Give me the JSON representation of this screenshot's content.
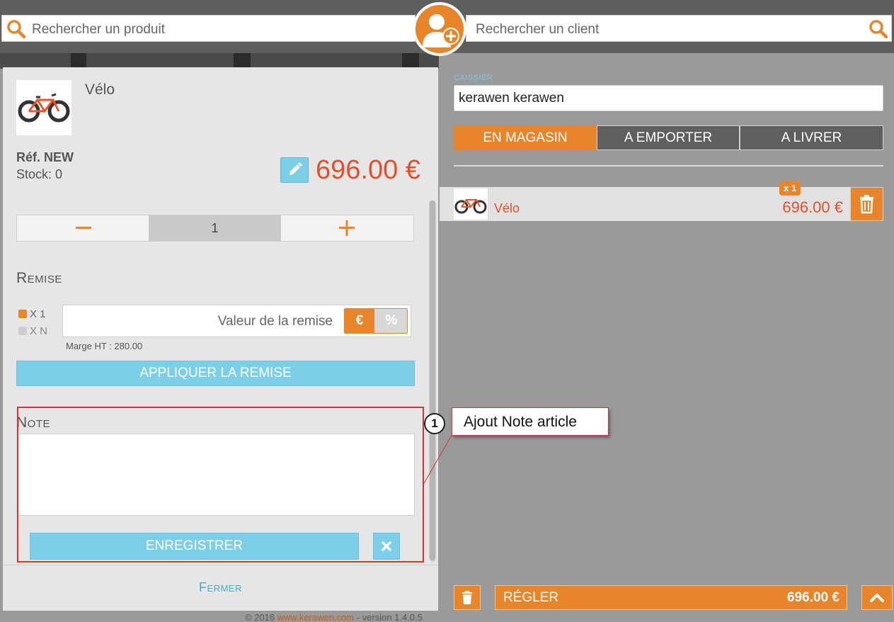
{
  "search": {
    "product_placeholder": "Rechercher un produit",
    "client_placeholder": "Rechercher un client"
  },
  "product": {
    "title": "Vélo",
    "ref": "Réf. NEW",
    "stock": "Stock: 0",
    "price": "696.00 €",
    "quantity": "1",
    "remise_title": "Remise",
    "option_x1": "X 1",
    "option_xn": "X N",
    "remise_placeholder": "Valeur de la remise",
    "unit_euro": "€",
    "unit_percent": "%",
    "marge": "Marge HT : 280.00",
    "apply_label": "APPLIQUER LA REMISE",
    "note_title": "Note",
    "save_label": "ENREGISTRER",
    "close_label": "Fermer"
  },
  "footer": {
    "copyright": "© 2016 ",
    "link": "www.kerawen.com",
    "version": " - version 1.4.0.5"
  },
  "cashier": {
    "label": "CAISSIER",
    "value": "kerawen kerawen"
  },
  "tabs": [
    {
      "label": "EN MAGASIN",
      "active": true
    },
    {
      "label": "A EMPORTER",
      "active": false
    },
    {
      "label": "A LIVRER",
      "active": false
    }
  ],
  "cart": {
    "item_name": "Vélo",
    "item_qty": "x 1",
    "item_price": "696.00 €"
  },
  "checkout": {
    "pay_label": "RÉGLER",
    "total": "696.00 €"
  },
  "callout": {
    "number": "1",
    "text": "Ajout Note article"
  },
  "colors": {
    "accent": "#e8852a",
    "price": "#e0512b",
    "button_blue": "#7dcfe9",
    "annotation_red": "#d9322e"
  },
  "icons": [
    "search-icon",
    "add-user-icon",
    "pencil-icon",
    "minus-icon",
    "plus-icon",
    "close-icon",
    "trash-icon",
    "chevron-up-icon",
    "bicycle-icon"
  ]
}
